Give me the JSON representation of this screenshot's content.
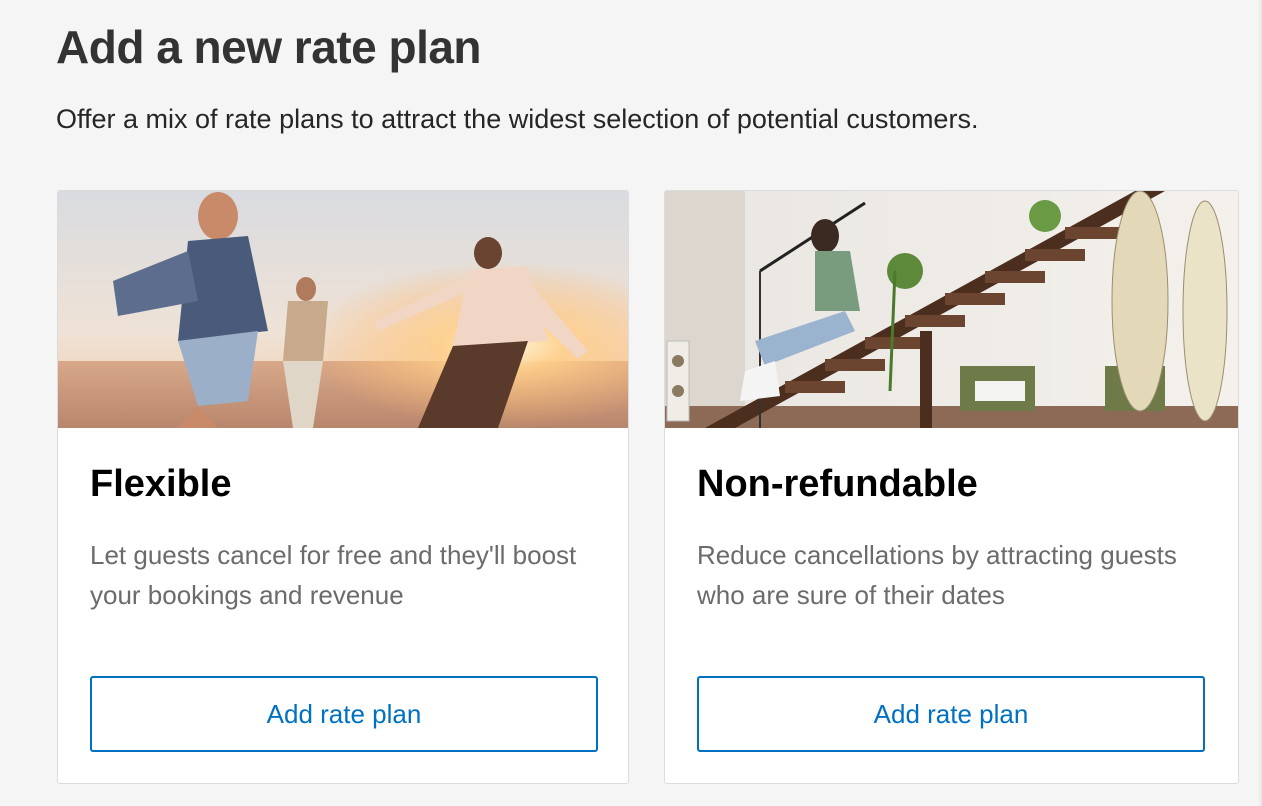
{
  "page": {
    "title": "Add a new rate plan",
    "subtitle": "Offer a mix of rate plans to attract the widest selection of potential customers."
  },
  "cards": [
    {
      "title": "Flexible",
      "description": "Let guests cancel for free and they'll boost your bookings and revenue",
      "button_label": "Add rate plan",
      "image_icon": "beach-friends-photo"
    },
    {
      "title": "Non-refundable",
      "description": "Reduce cancellations by attracting guests who are sure of their dates",
      "button_label": "Add rate plan",
      "image_icon": "staircase-woman-photo"
    }
  ],
  "colors": {
    "accent": "#0071c2",
    "background": "#f5f5f5",
    "card_border": "#dcdcdc",
    "description_text": "#6b6b6b"
  }
}
